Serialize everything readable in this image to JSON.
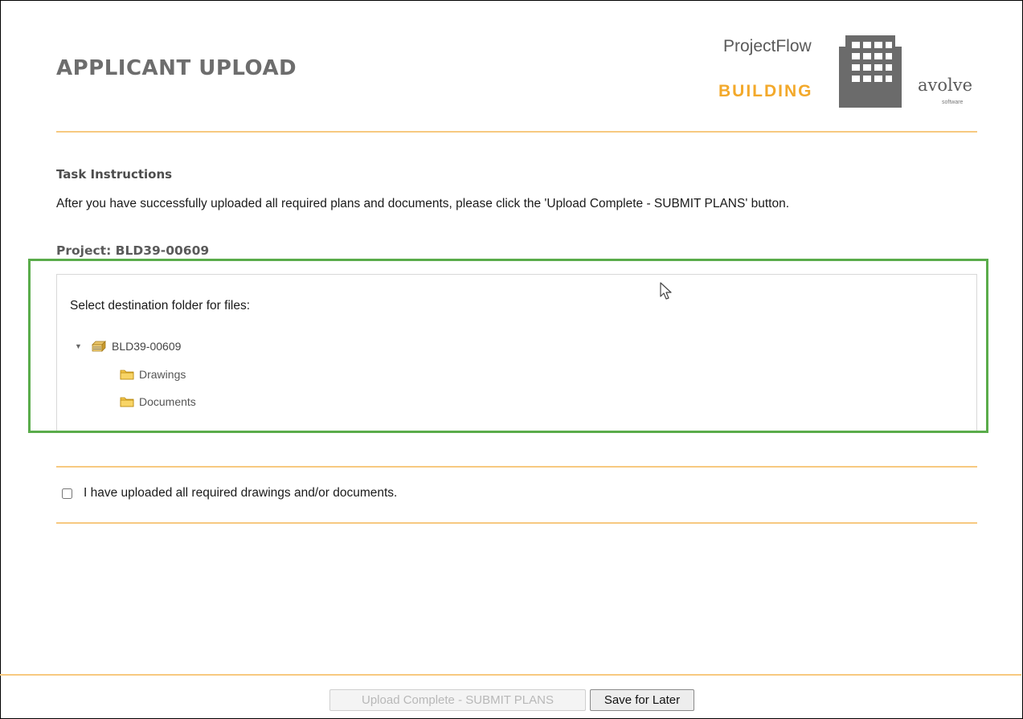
{
  "header": {
    "title": "APPLICANT UPLOAD",
    "logo": {
      "line1": "ProjectFlow",
      "line2": "BUILDING",
      "brand": "avolve",
      "brand_sub": "software"
    }
  },
  "task": {
    "heading": "Task Instructions",
    "instructions": "After you have successfully uploaded all required plans and documents, please click the 'Upload Complete - SUBMIT PLANS' button."
  },
  "project": {
    "label": "Project: BLD39-00609"
  },
  "folder_tree": {
    "title": "Select destination folder for files:",
    "root": {
      "label": "BLD39-00609",
      "icon": "folder-stack-icon",
      "expanded": true
    },
    "children": [
      {
        "label": "Drawings",
        "icon": "folder-icon"
      },
      {
        "label": "Documents",
        "icon": "folder-icon"
      }
    ]
  },
  "confirmation": {
    "label": "I have uploaded all required drawings and/or documents.",
    "checked": false
  },
  "actions": {
    "submit_label": "Upload Complete - SUBMIT PLANS",
    "submit_disabled": true,
    "save_label": "Save for Later"
  },
  "colors": {
    "accent_orange": "#f3a92b",
    "rule": "#f7c980",
    "highlight_green": "#5aac4b",
    "heading_gray": "#6d6d6d"
  }
}
